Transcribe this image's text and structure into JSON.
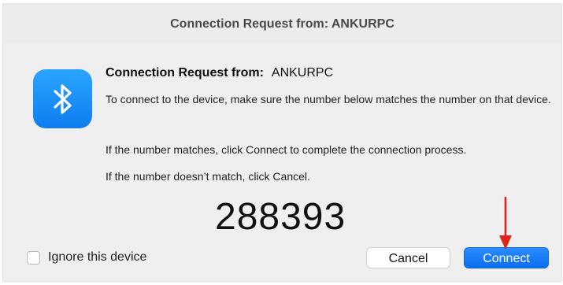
{
  "window": {
    "title": "Connection Request from: ANKURPC"
  },
  "dialog": {
    "icon": "bluetooth-icon",
    "heading_label": "Connection Request from:",
    "device_name": "ANKURPC",
    "paragraphs": [
      "To connect to the device, make sure the number below matches the number on that device.",
      "If the number matches, click Connect to complete the connection process.",
      "If the number doesn’t match, click Cancel."
    ],
    "passkey": "288393",
    "ignore_checkbox": {
      "label": "Ignore this device",
      "checked": false
    },
    "buttons": {
      "cancel": "Cancel",
      "connect": "Connect"
    }
  },
  "colors": {
    "accent": "#0a6ff0",
    "annotation_arrow": "#e0241b",
    "window_bg": "#ececec"
  }
}
